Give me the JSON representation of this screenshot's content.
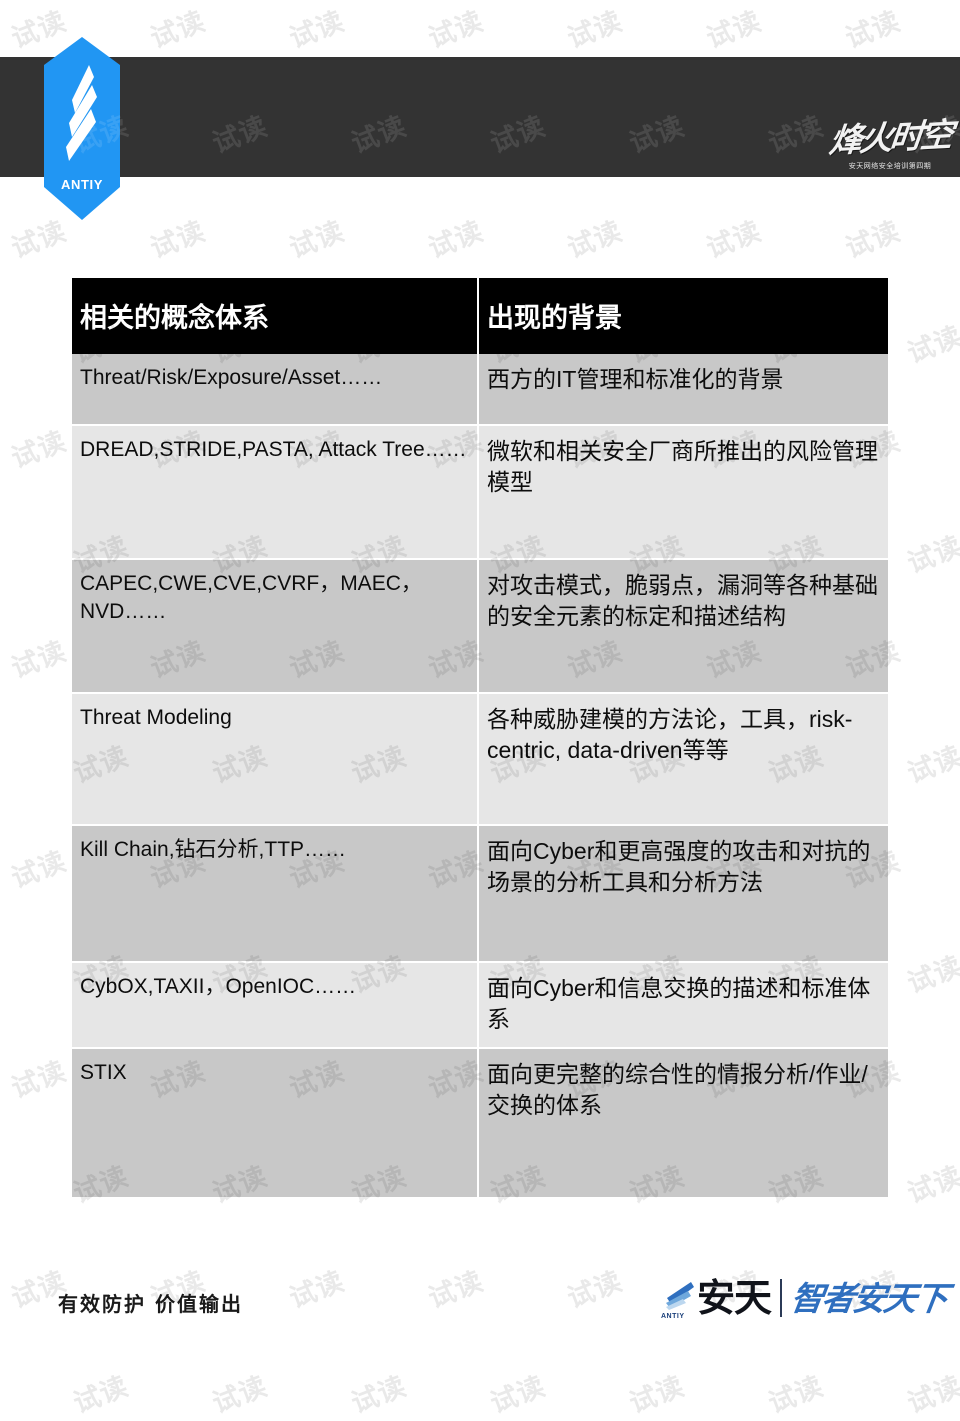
{
  "header": {
    "logo_name": "ANTIY",
    "logo_wordmark": "ANTIY",
    "course_calligraphy": "烽火时空",
    "course_subtitle": "安天网络安全培训第四期"
  },
  "watermark": {
    "text": "试读"
  },
  "table": {
    "columns": [
      "相关的概念体系",
      "出现的背景"
    ],
    "rows": [
      {
        "concept": "Threat/Risk/Exposure/Asset……",
        "background": "西方的IT管理和标准化的背景"
      },
      {
        "concept": "DREAD,STRIDE,PASTA, Attack Tree……",
        "background": "微软和相关安全厂商所推出的风险管理模型"
      },
      {
        "concept": "CAPEC,CWE,CVE,CVRF，MAEC，NVD……",
        "background": "对攻击模式，脆弱点，漏洞等各种基础的安全元素的标定和描述结构"
      },
      {
        "concept": "Threat Modeling",
        "background": "各种威胁建模的方法论，工具，risk-centric, data-driven等等"
      },
      {
        "concept": "Kill Chain,钻石分析,TTP……",
        "background": "面向Cyber和更高强度的攻击和对抗的场景的分析工具和分析方法"
      },
      {
        "concept": "CybOX,TAXII，OpenIOC……",
        "background": "面向Cyber和信息交换的描述和标准体系"
      },
      {
        "concept": "STIX",
        "background": "面向更完整的综合性的情报分析/作业/交换的体系"
      }
    ]
  },
  "footer": {
    "slogan": "有效防护 价值输出",
    "brand_en": "ANTIY",
    "brand_cn": "安天",
    "brand_tagline": "智者安天下"
  },
  "colors": {
    "header_band": "#333333",
    "logo_blue": "#2196F3",
    "table_header_bg": "#000000",
    "row_shade_dark": "#c8c8c8",
    "row_shade_light": "#e6e6e6",
    "brand_blue": "#2f6fbf"
  }
}
